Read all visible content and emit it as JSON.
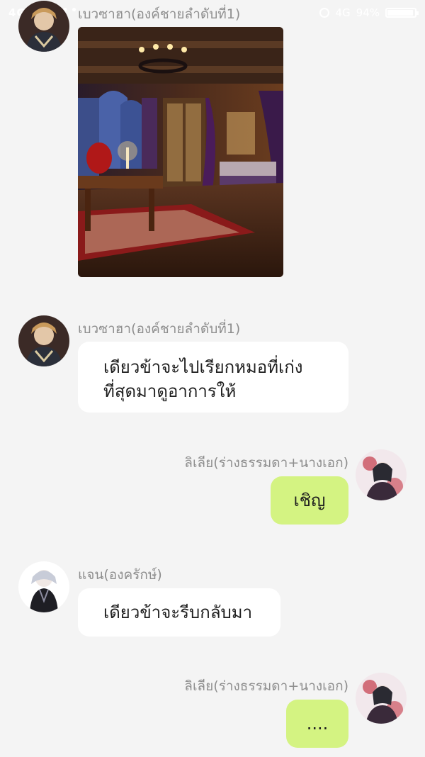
{
  "status_bar": {
    "signal": "4G ııl",
    "network": "4G",
    "battery": "94%",
    "battery_level": 0.94
  },
  "messages": [
    {
      "sender": "เบวซาฮา(องค์ชายลำดับที่1)",
      "type": "image",
      "image_desc": "room-scene"
    },
    {
      "sender": "เบวซาฮา(องค์ชายลำดับที่1)",
      "type": "text",
      "line1": "เดียวข้าจะไปเรียกหมอที่เก่ง",
      "line2": "ที่สุดมาดูอาการให้"
    },
    {
      "sender": "ลิเลีย(ร่างธรรมดา+นางเอก)",
      "type": "text",
      "text": "เชิญ"
    },
    {
      "sender": "แจน(องครักษ์)",
      "type": "text",
      "text": "เดียวข้าจะรีบกลับมา"
    },
    {
      "sender": "ลิเลีย(ร่างธรรมดา+นางเอก)",
      "type": "text",
      "text": "...."
    }
  ],
  "colors": {
    "background": "#f4f4f4",
    "bubble_left": "#ffffff",
    "bubble_right": "#d4f382",
    "name_text": "#8e8e8e"
  }
}
